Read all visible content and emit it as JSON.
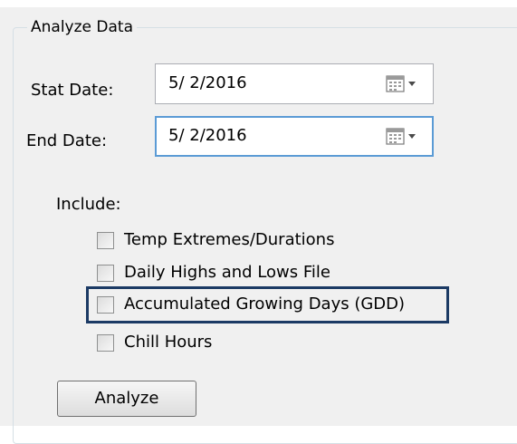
{
  "group": {
    "title": "Analyze Data"
  },
  "start_date": {
    "label": "Stat Date:",
    "value": "5/ 2/2016"
  },
  "end_date": {
    "label": "End Date:",
    "value": "5/ 2/2016"
  },
  "include": {
    "label": "Include:",
    "options": [
      {
        "label": "Temp Extremes/Durations",
        "checked": false
      },
      {
        "label": "Daily Highs and Lows File",
        "checked": false
      },
      {
        "label": "Accumulated Growing Days (GDD)",
        "checked": false,
        "highlighted": true
      },
      {
        "label": "Chill Hours",
        "checked": false
      }
    ]
  },
  "analyze_button": {
    "label": "Analyze"
  },
  "icons": {
    "calendar": "calendar-icon",
    "dropdown": "chevron-down-icon"
  },
  "colors": {
    "panel_bg": "#f0f0f0",
    "focus_border": "#5b9bd5",
    "highlight_border": "#1b3a64"
  }
}
